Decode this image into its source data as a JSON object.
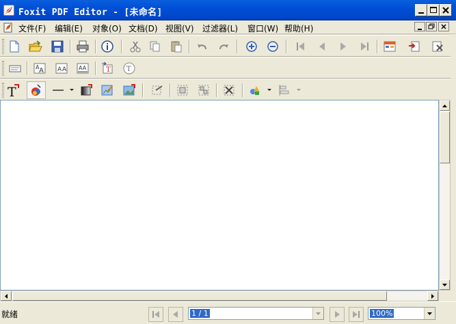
{
  "window": {
    "title": "Foxit PDF Editor - [未命名]"
  },
  "menu": {
    "items": [
      {
        "label": "文件(F)"
      },
      {
        "label": "编辑(E)"
      },
      {
        "label": "对象(O)"
      },
      {
        "label": "文档(D)"
      },
      {
        "label": "视图(V)"
      },
      {
        "label": "过滤器(L)"
      },
      {
        "label": "窗口(W)"
      },
      {
        "label": "帮助(H)"
      }
    ]
  },
  "toolbars": {
    "row1": [
      "new-icon",
      "open-icon",
      "save-icon",
      "print-icon",
      "info-icon",
      "cut-icon",
      "copy-icon",
      "paste-icon",
      "undo-icon",
      "redo-icon",
      "zoom-in-icon",
      "zoom-out-icon",
      "first-page-icon",
      "previous-page-icon",
      "next-page-icon",
      "last-page-icon",
      "page-properties-icon",
      "import-page-icon",
      "delete-page-icon"
    ],
    "row2": [
      "text-box-icon",
      "font-scale-icon",
      "char-spacing-icon",
      "word-spacing-icon",
      "text-to-image-icon",
      "text-position-icon"
    ],
    "row3": [
      "add-text-icon",
      "color-picker-icon",
      "line-icon",
      "shading-icon",
      "edit-image-icon",
      "insert-image-icon",
      "convert-to-shape-icon",
      "group-icon",
      "ungroup-icon",
      "delete-object-icon",
      "objects-icon",
      "align-icon"
    ]
  },
  "status": {
    "text": "就绪",
    "page_value": "1 / 1",
    "zoom_value": "100%"
  },
  "colors": {
    "titlebar": "#0050d8",
    "chrome": "#ece9d8",
    "selection": "#316ac5"
  }
}
